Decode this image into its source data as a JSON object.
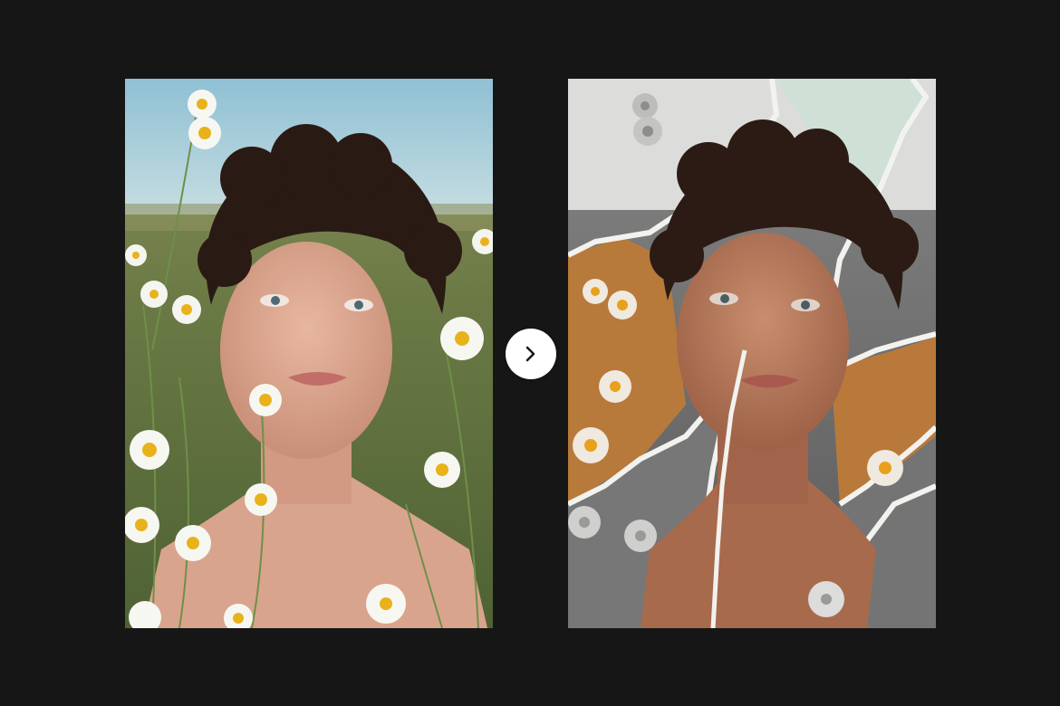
{
  "colors": {
    "background": "#161616",
    "button_bg": "#ffffff",
    "button_icon": "#1a1a1a"
  },
  "before_panel": {
    "image": "portrait-in-daisy-field"
  },
  "after_panel": {
    "image": "torn-paper-collage-portrait"
  },
  "compare_button": {
    "icon": "chevron-right-icon"
  }
}
